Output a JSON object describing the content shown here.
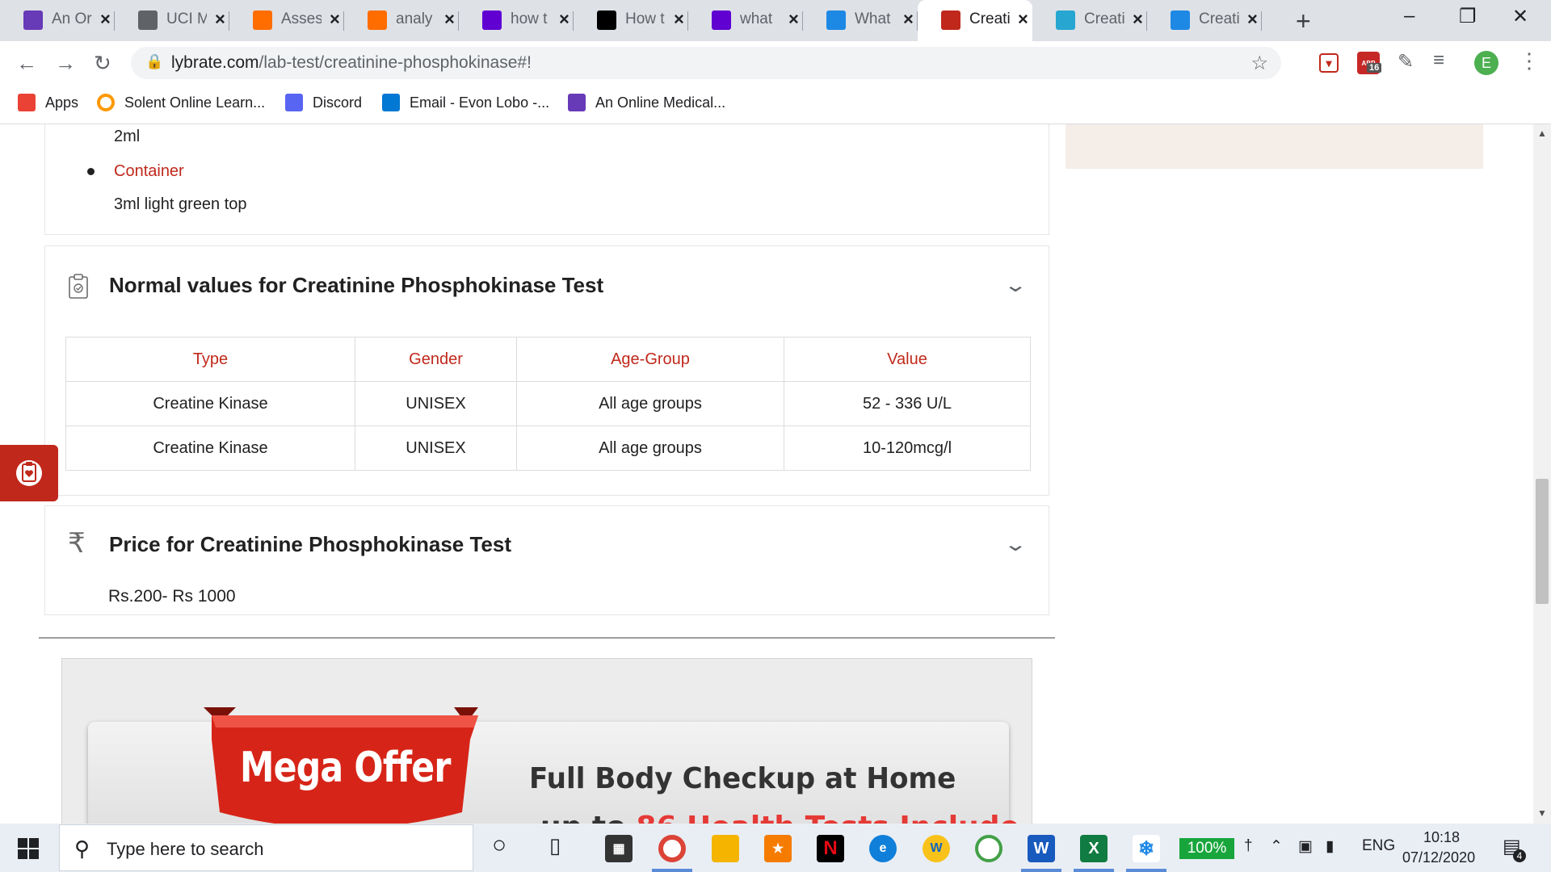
{
  "browser": {
    "tabs": [
      {
        "title": "An Or",
        "icon": "forms-icon",
        "color": "#673ab7",
        "active": false
      },
      {
        "title": "UCI M",
        "icon": "globe-icon",
        "color": "#5f6368",
        "active": false
      },
      {
        "title": "Asses",
        "icon": "loading-ring-icon",
        "color": "#ff6d00",
        "active": false
      },
      {
        "title": "analy",
        "icon": "book-icon",
        "color": "#ff6d00",
        "active": false
      },
      {
        "title": "how t",
        "icon": "yahoo-icon",
        "color": "#6001d2",
        "active": false
      },
      {
        "title": "How t",
        "icon": "esp-icon",
        "color": "#000000",
        "active": false
      },
      {
        "title": "what",
        "icon": "yahoo-icon",
        "color": "#6001d2",
        "active": false
      },
      {
        "title": "What",
        "icon": "heart-icon",
        "color": "#1e88e5",
        "active": false
      },
      {
        "title": "Creati",
        "icon": "medical-cross-icon",
        "color": "#c0281b",
        "active": true
      },
      {
        "title": "Creati",
        "icon": "molecule-icon",
        "color": "#26a6d1",
        "active": false
      },
      {
        "title": "Creati",
        "icon": "docs-plus-icon",
        "color": "#1e88e5",
        "active": false
      }
    ],
    "url": {
      "domain": "lybrate.com",
      "path": "/lab-test/creatinine-phosphokinase#!"
    },
    "extension_badge": "16",
    "extension_badge_top": "ABP",
    "profile_initial": "E",
    "bookmarks": [
      {
        "label": "Apps",
        "icon": "apps-grid-icon"
      },
      {
        "label": "Solent Online Learn...",
        "icon": "ring-icon"
      },
      {
        "label": "Discord",
        "icon": "discord-icon"
      },
      {
        "label": "Email - Evon Lobo -...",
        "icon": "outlook-icon"
      },
      {
        "label": "An Online Medical...",
        "icon": "forms-icon"
      }
    ]
  },
  "page": {
    "sample_card": {
      "volume_value": "2ml",
      "container_label": "Container",
      "container_value": "3ml light green top"
    },
    "normal_values": {
      "title": "Normal values for Creatinine Phosphokinase Test",
      "headers": [
        "Type",
        "Gender",
        "Age-Group",
        "Value"
      ],
      "rows": [
        [
          "Creatine Kinase",
          "UNISEX",
          "All age groups",
          "52 - 336 U/L"
        ],
        [
          "Creatine Kinase",
          "UNISEX",
          "All age groups",
          "10-120mcg/l"
        ]
      ]
    },
    "price": {
      "title": "Price for Creatinine Phosphokinase Test",
      "value": "Rs.200- Rs 1000"
    },
    "banner": {
      "badge": "Mega Offer",
      "headline": "Full Body Checkup at Home",
      "subline_prefix": "up to ",
      "subline_highlight": "86 Health Tests Include"
    },
    "accent_color": "#c0281b"
  },
  "taskbar": {
    "search_placeholder": "Type here to search",
    "battery": "100%",
    "language": "ENG",
    "time": "10:18",
    "date": "07/12/2020",
    "notification_count": "4"
  }
}
